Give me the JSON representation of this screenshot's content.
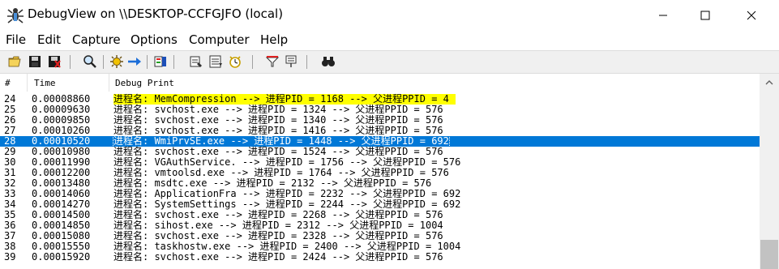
{
  "window": {
    "title": "DebugView on \\\\DESKTOP-CCFGJFO (local)"
  },
  "menu": [
    "File",
    "Edit",
    "Capture",
    "Options",
    "Computer",
    "Help"
  ],
  "toolbar": {
    "buttons": [
      "open-icon",
      "save-icon",
      "clear-icon",
      "find-icon",
      "capture-icon",
      "autoscroll-icon",
      "filter-icon",
      "clock-icon",
      "history-icon",
      "timer-icon",
      "highlight-icon",
      "bookmark-icon",
      "binoculars-icon"
    ]
  },
  "columns": {
    "num": "#",
    "time": "Time",
    "msg": "Debug Print"
  },
  "rows": [
    {
      "num": "24",
      "time": "0.00008860",
      "msg": "进程名: MemCompression --> 进程PID = 1168 --> 父进程PPID = 4",
      "state": "highlight"
    },
    {
      "num": "25",
      "time": "0.00009630",
      "msg": "进程名: svchost.exe --> 进程PID = 1324 --> 父进程PPID = 576",
      "state": ""
    },
    {
      "num": "26",
      "time": "0.00009850",
      "msg": "进程名: svchost.exe --> 进程PID = 1340 --> 父进程PPID = 576",
      "state": ""
    },
    {
      "num": "27",
      "time": "0.00010260",
      "msg": "进程名: svchost.exe --> 进程PID = 1416 --> 父进程PPID = 576",
      "state": ""
    },
    {
      "num": "28",
      "time": "0.00010520",
      "msg": "进程名: WmiPrvSE.exe --> 进程PID = 1448 --> 父进程PPID = 692",
      "state": "selected"
    },
    {
      "num": "29",
      "time": "0.00010980",
      "msg": "进程名: svchost.exe --> 进程PID = 1524 --> 父进程PPID = 576",
      "state": ""
    },
    {
      "num": "30",
      "time": "0.00011990",
      "msg": "进程名: VGAuthService. --> 进程PID = 1756 --> 父进程PPID = 576",
      "state": ""
    },
    {
      "num": "31",
      "time": "0.00012200",
      "msg": "进程名: vmtoolsd.exe --> 进程PID = 1764 --> 父进程PPID = 576",
      "state": ""
    },
    {
      "num": "32",
      "time": "0.00013480",
      "msg": "进程名: msdtc.exe --> 进程PID = 2132 --> 父进程PPID = 576",
      "state": ""
    },
    {
      "num": "33",
      "time": "0.00014060",
      "msg": "进程名: ApplicationFra --> 进程PID = 2232 --> 父进程PPID = 692",
      "state": ""
    },
    {
      "num": "34",
      "time": "0.00014270",
      "msg": "进程名: SystemSettings --> 进程PID = 2244 --> 父进程PPID = 692",
      "state": ""
    },
    {
      "num": "35",
      "time": "0.00014500",
      "msg": "进程名: svchost.exe --> 进程PID = 2268 --> 父进程PPID = 576",
      "state": ""
    },
    {
      "num": "36",
      "time": "0.00014850",
      "msg": "进程名: sihost.exe --> 进程PID = 2312 --> 父进程PPID = 1004",
      "state": ""
    },
    {
      "num": "37",
      "time": "0.00015080",
      "msg": "进程名: svchost.exe --> 进程PID = 2328 --> 父进程PPID = 576",
      "state": ""
    },
    {
      "num": "38",
      "time": "0.00015550",
      "msg": "进程名: taskhostw.exe --> 进程PID = 2400 --> 父进程PPID = 1004",
      "state": ""
    },
    {
      "num": "39",
      "time": "0.00015920",
      "msg": "进程名: svchost.exe --> 进程PID = 2424 --> 父进程PPID = 576",
      "state": ""
    }
  ],
  "colors": {
    "highlight": "#ffff00",
    "selected": "#0078d7"
  }
}
